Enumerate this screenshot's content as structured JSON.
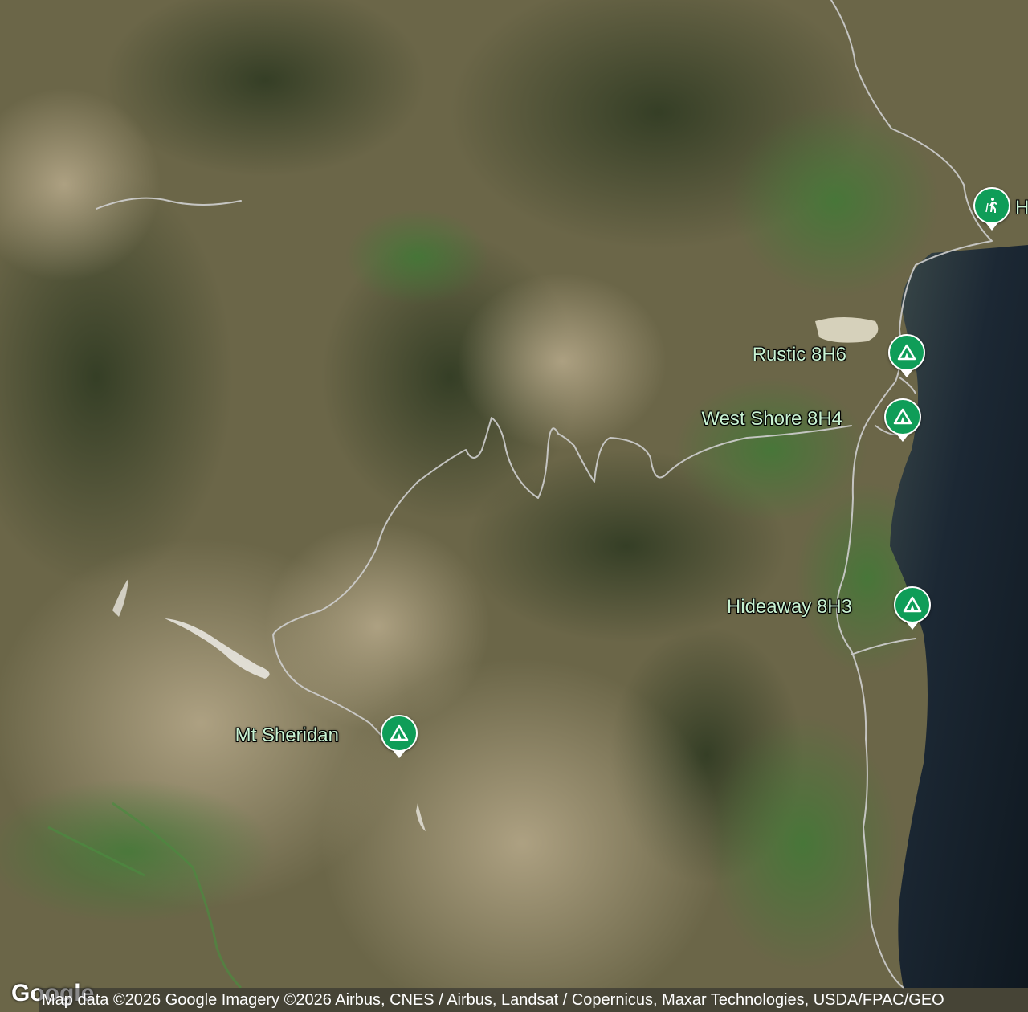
{
  "map": {
    "type": "satellite",
    "colors": {
      "marker": "#0f9d58",
      "label_text": "#c8f2d2",
      "water": "#1a2530",
      "road": "#cfcfcf"
    }
  },
  "markers": [
    {
      "id": "trailhead",
      "label": "H",
      "icon": "hiker-icon"
    },
    {
      "id": "rustic",
      "label": "Rustic 8H6",
      "icon": "campground-icon"
    },
    {
      "id": "west-shore",
      "label": "West Shore 8H4",
      "icon": "campground-icon"
    },
    {
      "id": "hideaway",
      "label": "Hideaway 8H3",
      "icon": "campground-icon"
    },
    {
      "id": "mt-sheridan",
      "label": "Mt Sheridan",
      "icon": "campground-icon"
    }
  ],
  "attribution": "Map data ©2026 Google Imagery ©2026 Airbus, CNES / Airbus, Landsat / Copernicus, Maxar Technologies, USDA/FPAC/GEO",
  "logo": "Google"
}
